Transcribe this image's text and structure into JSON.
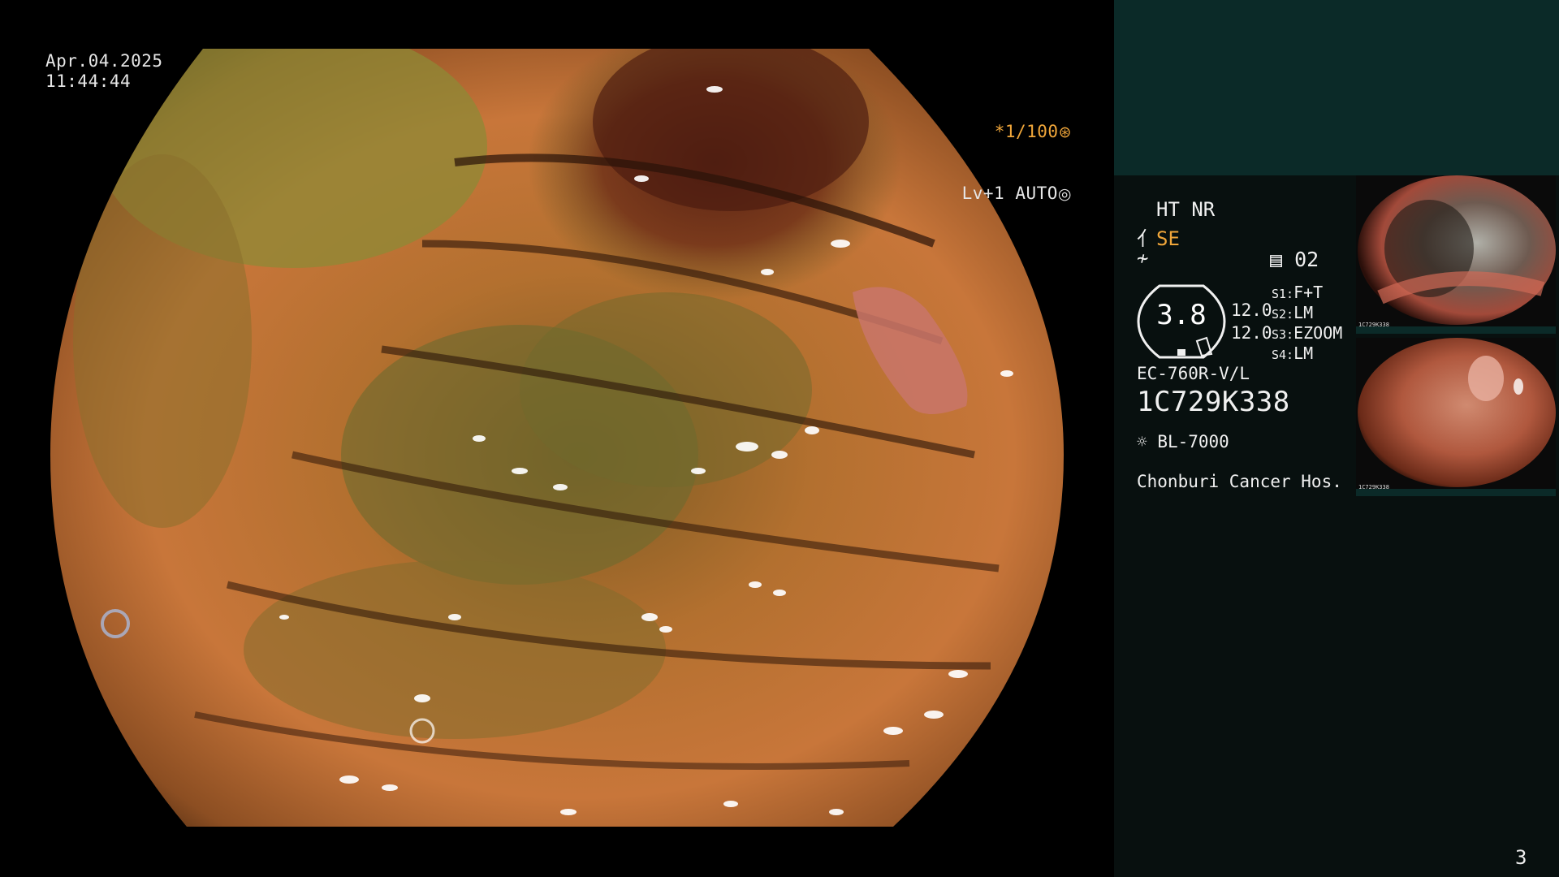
{
  "overlay": {
    "date": "Apr.04.2025",
    "time": "11:44:44",
    "shutter": "*1/100",
    "shutter_icon": "aperture-icon",
    "enhance": "Lv+1 AUTO",
    "enhance_icon": "iris-icon"
  },
  "info": {
    "ht_nr": "HT NR",
    "se_label": "SE",
    "se_icon": "structure-enhance-icon",
    "structure_icon": "edge-enhance-icon",
    "memo_icon": "memo-icon",
    "memo_count": "02",
    "gauge_value": "3.8",
    "gauge_v1": "12.0",
    "gauge_v2": "12.0",
    "switches": [
      {
        "key": "S1:",
        "value": "F+T"
      },
      {
        "key": "S2:",
        "value": "LM"
      },
      {
        "key": "S3:",
        "value": "EZOOM"
      },
      {
        "key": "S4:",
        "value": "LM"
      }
    ],
    "scope_model": "EC-760R-V/L",
    "scope_serial": "1C729K338",
    "light_icon": "light-source-icon",
    "light_source": "BL-7000",
    "hospital": "Chonburi Cancer Hos."
  },
  "thumbnails": [
    {
      "label": "1C729K338"
    },
    {
      "label": "1C729K338"
    }
  ],
  "page_number": "3",
  "colors": {
    "accent_orange": "#f0a63a",
    "panel_teal": "#0b2a28",
    "panel_dark": "#08100f"
  }
}
